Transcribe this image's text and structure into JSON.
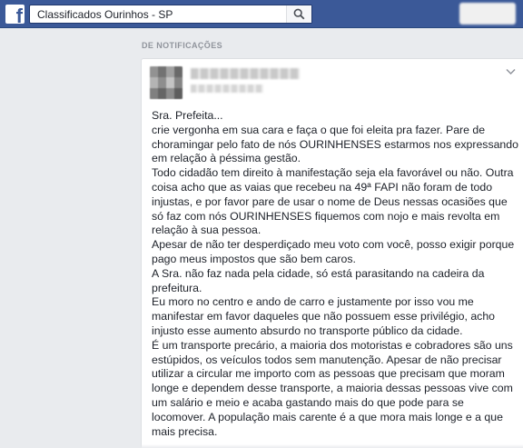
{
  "topbar": {
    "logo_letter": "f",
    "search_value": "Classificados Ourinhos - SP"
  },
  "section_label": "DE NOTIFICAÇÕES",
  "post": {
    "lines": [
      "Sra. Prefeita...",
      "crie vergonha em sua cara e faça o que foi eleita pra fazer. Pare de",
      "choramingar pelo fato de nós OURINHENSES estarmos nos expressando",
      "em relação à péssima gestão.",
      "Todo cidadão tem direito à manifestação seja ela favorável ou não. Outra",
      "coisa acho que as vaias que recebeu na 49ª FAPI não foram de todo",
      "injustas, e por favor pare de usar o nome de Deus nessas ocasiões que",
      "só faz com nós OURINHENSES fiquemos com nojo e mais revolta em",
      "relação à sua pessoa.",
      "Apesar de não ter desperdiçado meu voto com você, posso exigir porque",
      "pago meus impostos que são bem caros.",
      "A Sra. não faz nada pela cidade, só está parasitando na cadeira da",
      "prefeitura.",
      "Eu moro no centro e ando de carro e justamente por isso vou me",
      "manifestar em favor daqueles que não possuem esse privilégio, acho",
      "injusto esse aumento absurdo no transporte público da cidade.",
      "É um transporte precário, a maioria dos motoristas e cobradores são uns",
      "estúpidos, os veículos todos sem manutenção. Apesar de não precisar",
      "utilizar a circular me importo com as pessoas que precisam que moram",
      "longe e dependem desse transporte, a maioria dessas pessoas vive com",
      "um salário e meio e acaba gastando mais do que pode para se",
      "locomover. A população mais carente é a que mora mais longe e a que",
      "mais precisa."
    ]
  },
  "icons": {
    "search": "search-icon",
    "chevron": "chevron-down-icon",
    "logo": "facebook-logo-icon"
  },
  "colors": {
    "brand": "#3b5998",
    "background": "#e9ebee",
    "text": "#1d2129",
    "muted": "#90949c"
  }
}
